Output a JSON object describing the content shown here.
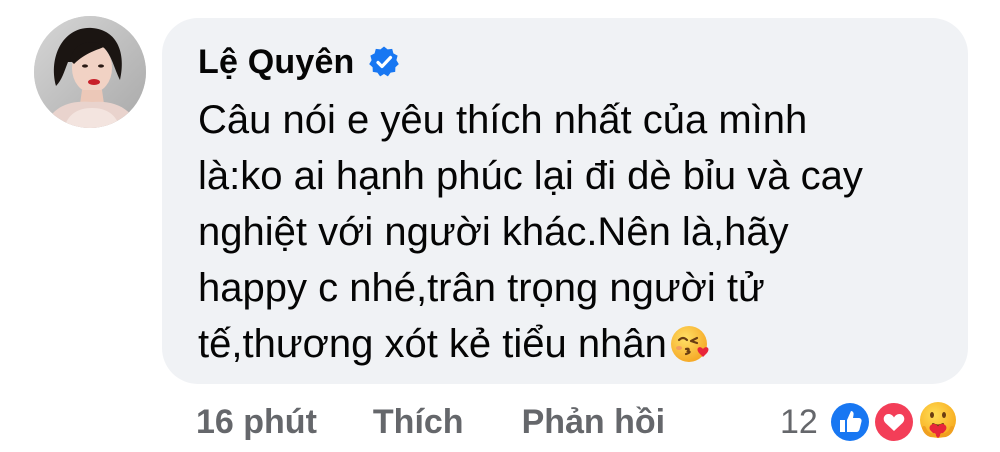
{
  "comment": {
    "author": {
      "name": "Lệ Quyên",
      "verified": true
    },
    "text_lines": [
      "Câu nói e yêu thích nhất của mình",
      "là:ko ai hạnh phúc lại đi dè bỉu và cay",
      "nghiệt với người khác.Nên là,hãy",
      "happy c nhé,trân trọng người tử",
      "tế,thương xót kẻ tiểu nhân"
    ],
    "trailing_emoji": "face-blowing-a-kiss-icon"
  },
  "actions": {
    "time": "16 phút",
    "like_label": "Thích",
    "reply_label": "Phản hồi"
  },
  "reactions": {
    "count": "12",
    "types": [
      "like-reaction-icon",
      "love-reaction-icon",
      "care-reaction-icon"
    ]
  },
  "colors": {
    "bubble": "#f0f2f5",
    "text": "#050505",
    "secondary": "#65676b",
    "verified": "#1877f2",
    "like": "#1877f2",
    "love": "#f33e58",
    "care": "#f7b125"
  }
}
